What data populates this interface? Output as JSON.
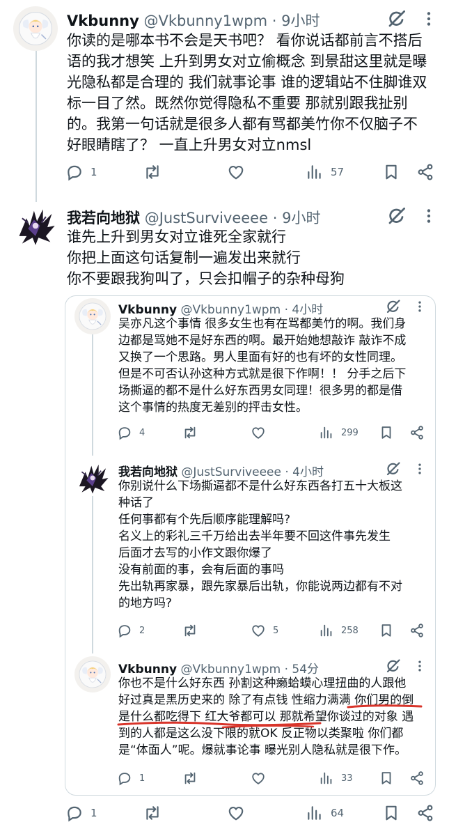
{
  "tweets": [
    {
      "name": "Vkbunny",
      "handle": "@Vkbunny1wpm",
      "time": "9小时",
      "text": "你读的是哪本书不会是天书吧？ 看你说话都前言不搭后\n语的我才想笑 上升到男女对立偷概念 到景甜这里就是曝\n光隐私都是合理的 我们就事论事 谁的逻辑站不住脚谁双\n标一目了然。既然你觉得隐私不重要 那就别跟我扯别\n的。我第一句话就是很多人都有骂都美竹你不仅脑子不\n好眼睛瞎了？ 一直上升男女对立nmsl",
      "replies": "1",
      "retweets": "",
      "likes": "",
      "views": "57"
    },
    {
      "name": "我若向地狱",
      "handle": "@JustSurviveeee",
      "time": "9小时",
      "text": "谁先上升到男女对立谁死全家就行\n你把上面这句话复制一遍发出来就行\n你不要跟我狗叫了，只会扣帽子的杂种母狗",
      "replies": "",
      "retweets": "",
      "likes": "",
      "views": ""
    }
  ],
  "nested": [
    {
      "name": "Vkbunny",
      "handle": "@Vkbunny1wpm",
      "time": "4小时",
      "text": "吴亦凡这个事情 很多女生也有在骂都美竹的啊。我们身\n边都是骂她不是好东西的啊。最开始她想敲诈 敲诈不成\n又换了一个思路。男人里面有好的也有坏的女性同理。\n但是不可否认孙这种方式就是很下作啊！！ 分手之后下\n场撕逼的都不是什么好东西男女同理！很多男的都是借\n这个事情的热度无差别的抨击女性。",
      "replies": "4",
      "retweets": "",
      "likes": "",
      "views": "299"
    },
    {
      "name": "我若向地狱",
      "handle": "@JustSurviveeee",
      "time": "4小时",
      "text": "你别说什么下场撕逼都不是什么好东西各打五十大板这\n种话了\n任何事都有个先后顺序能理解吗?\n名义上的彩礼三千万给出去半年要不回这件事先发生\n后面才去写的小作文跟你爆了\n没有前面的事，会有后面的事吗\n先出轨再家暴，跟先家暴后出轨，你能说两边都有不对\n的地方吗?",
      "replies": "2",
      "retweets": "",
      "likes": "5",
      "views": "258"
    },
    {
      "name": "Vkbunny",
      "handle": "@Vkbunny1wpm",
      "time": "54分",
      "text": "你也不是什么好东西 孙割这种癞蛤蟆心理扭曲的人跟他\n好过真是黑历史来的 除了有点钱 性缩力满满 你们男的倒\n是什么都吃得下 红大爷都可以 那就希望你谈过的对象 遇\n到的人都是这么没下限的就OK 反正物以类聚啦 你们都\n是“体面人”呢。爆就事论事 曝光别人隐私就是很下作。",
      "replies": "1",
      "retweets": "",
      "likes": "",
      "views": "33"
    }
  ],
  "bottom_bar": {
    "replies": "1",
    "views": "64"
  },
  "colors": {
    "text": "#0f1419",
    "muted": "#536471",
    "border": "#cfd9de",
    "annotation": "#d8342a"
  },
  "icons": [
    "grok-icon",
    "more-icon",
    "reply-icon",
    "retweet-icon",
    "like-icon",
    "views-icon",
    "bookmark-icon",
    "share-icon"
  ]
}
